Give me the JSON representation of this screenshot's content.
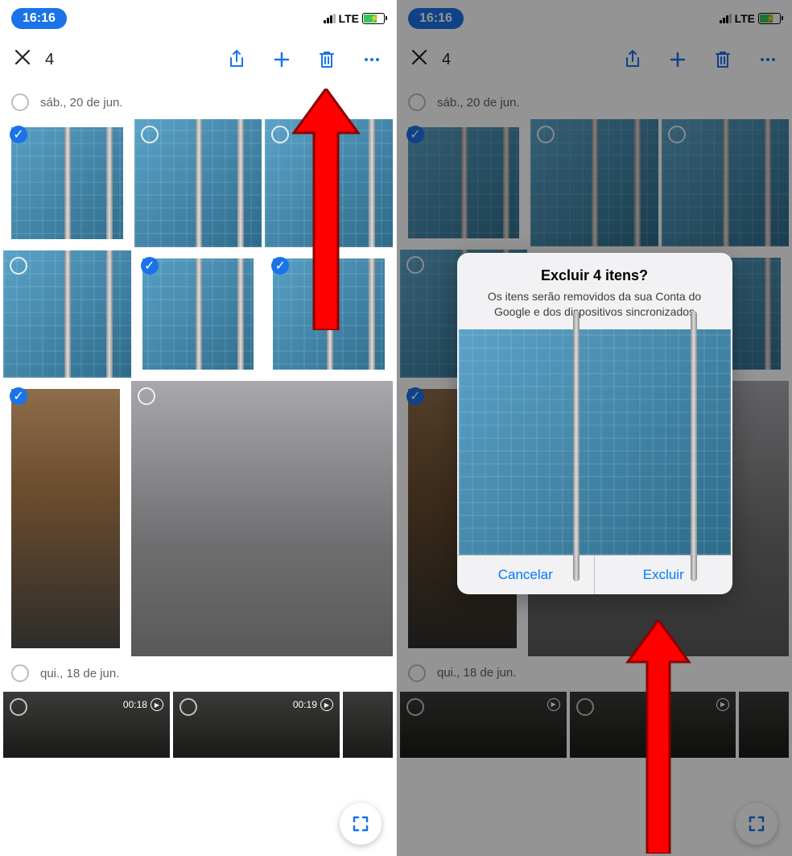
{
  "status": {
    "time": "16:16",
    "network": "LTE"
  },
  "toolbar": {
    "selected_count": "4"
  },
  "sections": [
    {
      "date": "sáb., 20 de jun."
    },
    {
      "date": "qui., 18 de jun."
    }
  ],
  "videos": [
    {
      "duration": "00:18"
    },
    {
      "duration": "00:19"
    }
  ],
  "dialog": {
    "title": "Excluir 4 itens?",
    "message": "Os itens serão removidos da sua Conta do Google e dos dispositivos sincronizados",
    "cancel": "Cancelar",
    "confirm": "Excluir"
  },
  "colors": {
    "primary": "#1a73e8",
    "ios_blue": "#007aff"
  }
}
